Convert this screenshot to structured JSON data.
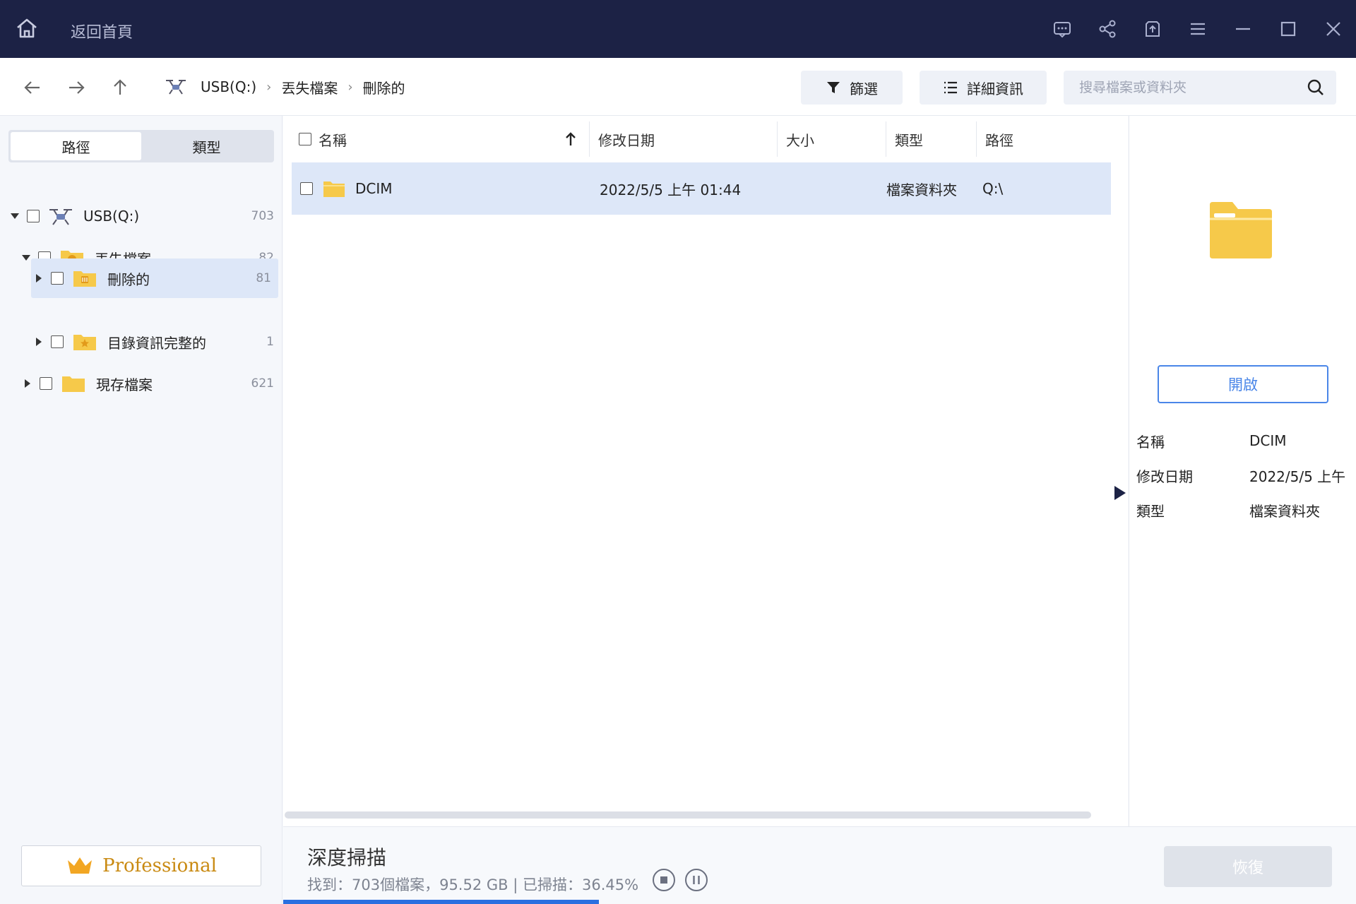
{
  "titlebar": {
    "back_home_label": "返回首頁"
  },
  "breadcrumb": {
    "items": [
      "USB(Q:)",
      "丟失檔案",
      "刪除的"
    ]
  },
  "toolbar": {
    "filter_label": "篩選",
    "details_label": "詳細資訊"
  },
  "search": {
    "placeholder": "搜尋檔案或資料夾"
  },
  "sidebar": {
    "tabs": [
      "路徑",
      "類型"
    ],
    "tree": [
      {
        "label": "USB(Q:)",
        "count": "703"
      },
      {
        "label": "丟失檔案",
        "count": "82"
      },
      {
        "label": "刪除的",
        "count": "81"
      },
      {
        "label": "目錄資訊完整的",
        "count": "1"
      },
      {
        "label": "現存檔案",
        "count": "621"
      }
    ],
    "professional_label": "Professional"
  },
  "table": {
    "headers": [
      "名稱",
      "修改日期",
      "大小",
      "類型",
      "路徑"
    ],
    "rows": [
      {
        "name": "DCIM",
        "modified": "2022/5/5 上午 01:44",
        "size": "",
        "type": "檔案資料夾",
        "path": "Q:\\"
      }
    ]
  },
  "details": {
    "open_label": "開啟",
    "properties": [
      {
        "key": "名稱",
        "value": "DCIM"
      },
      {
        "key": "修改日期",
        "value": "2022/5/5 上午 .."
      },
      {
        "key": "類型",
        "value": "檔案資料夾"
      }
    ]
  },
  "status": {
    "title": "深度掃描",
    "info": "找到：703個檔案，95.52 GB | 已掃描：36.45%",
    "progress": 0.2945,
    "recover_label": "恢復"
  },
  "colors": {
    "titlebar": "#1c2245",
    "accent": "#2a6fe0",
    "folder": "#f6c94a",
    "selection": "#dde7f8"
  }
}
